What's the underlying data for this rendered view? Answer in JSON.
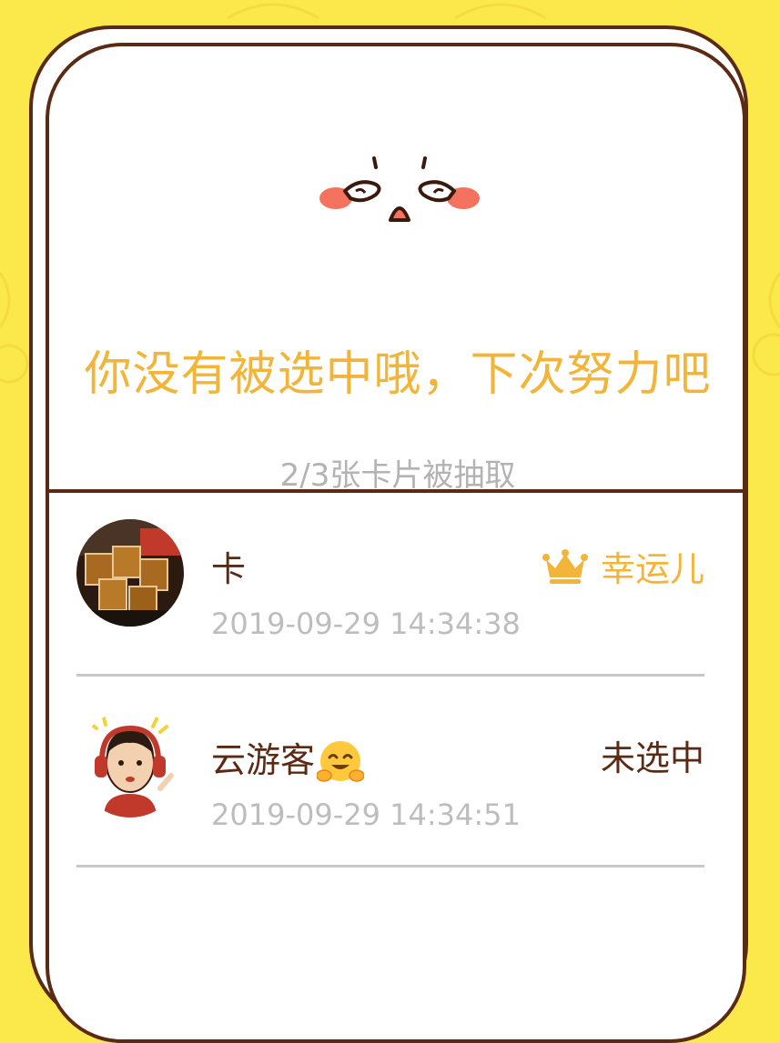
{
  "result": {
    "title": "你没有被选中哦，下次努力吧",
    "subtitle": "2/3张卡片被抽取"
  },
  "entries": [
    {
      "name": "卡",
      "time": "2019-09-29 14:34:38",
      "status": "幸运儿",
      "status_icon": "crown-icon",
      "avatar": "photo-of-drinks"
    },
    {
      "name": "云游客",
      "time": "2019-09-29 14:34:51",
      "status": "未选中",
      "name_emoji": "hugging-face-emoji",
      "avatar": "cartoon-headphones"
    }
  ],
  "colors": {
    "background": "#fbe84a",
    "accent": "#f2b53a",
    "border": "#5a2a14",
    "muted": "#b3b3b3"
  }
}
